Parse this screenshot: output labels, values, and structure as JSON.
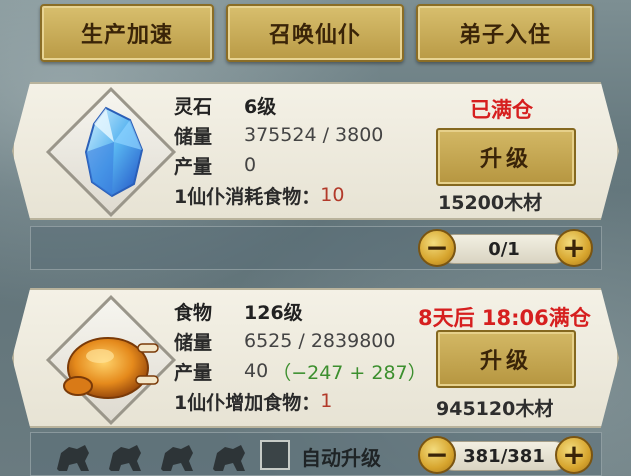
{
  "top_buttons": {
    "speed_up": "生产加速",
    "summon": "召唤仙仆",
    "disciples": "弟子入住"
  },
  "resources": [
    {
      "name": "灵石",
      "level": "6级",
      "storage_label": "储量",
      "storage_value": "375524 / 3800",
      "output_label": "产量",
      "output_value": "0",
      "output_delta": "",
      "consume_label": "1仙仆消耗食物：",
      "consume_value": "10",
      "status": "已满仓",
      "upgrade_label": "升级",
      "cost": "15200木材",
      "icon": "spirit-stone-icon"
    },
    {
      "name": "食物",
      "level": "126级",
      "storage_label": "储量",
      "storage_value": "6525 / 2839800",
      "output_label": "产量",
      "output_value": "40",
      "output_delta": "（−247 + 287）",
      "consume_label": "1仙仆增加食物：",
      "consume_value": "1",
      "status": "8天后 18:06满仓",
      "upgrade_label": "升级",
      "cost": "945120木材",
      "icon": "roast-chicken-icon"
    }
  ],
  "bars": {
    "stone_counter": "0/1",
    "food_counter": "381/381",
    "auto_upgrade_label": "自动升级",
    "minus_symbol": "−",
    "plus_symbol": "+"
  },
  "colors": {
    "gold_button": "#c9ac55",
    "status_red": "#d61f1f",
    "delta_green": "#3c8f2e",
    "consume_red": "#b23a2a"
  }
}
